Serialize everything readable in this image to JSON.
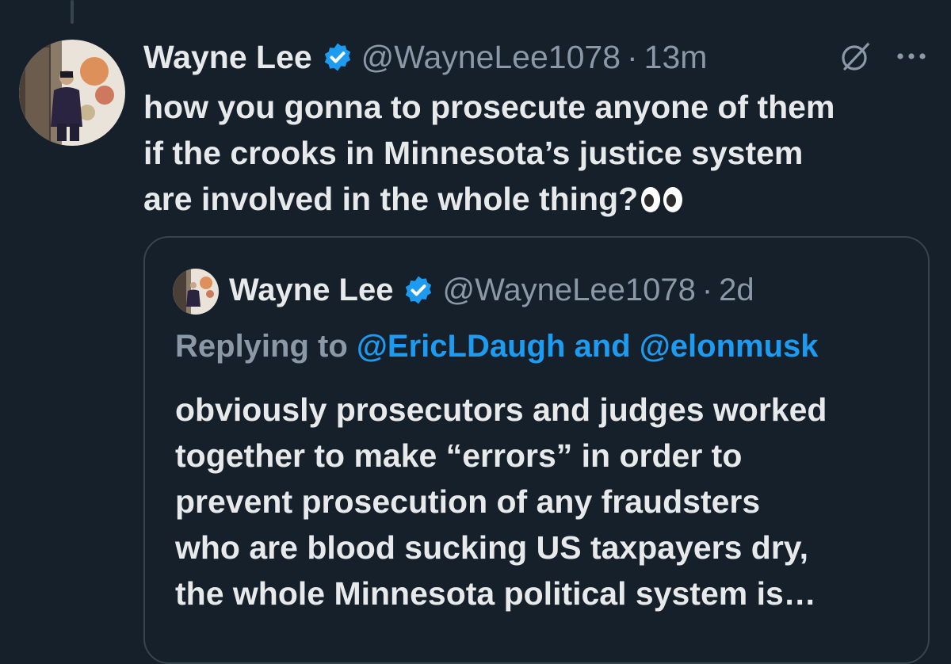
{
  "tweet": {
    "author_name": "Wayne Lee",
    "handle": "@WayneLee1078",
    "separator": "·",
    "time": "13m",
    "text_lines": [
      "how you gonna to prosecute anyone of them",
      "if the crooks in Minnesota’s justice system",
      "are involved in the whole thing?"
    ],
    "emoji": "eyes-emoji"
  },
  "quoted_tweet": {
    "author_name": "Wayne Lee",
    "handle": "@WayneLee1078",
    "separator": "·",
    "time": "2d",
    "replying_prefix": "Replying to",
    "mention_1": "@EricLDaugh",
    "mention_joiner": "and",
    "mention_2": "@elonmusk",
    "text_lines": [
      "obviously prosecutors and judges worked",
      "together to make “errors” in order to",
      "prevent prosecution of any fraudsters",
      "who are blood sucking US taxpayers dry,",
      "the whole Minnesota political system is…"
    ]
  },
  "icons": {
    "verified": "verified-badge-icon",
    "grok": "grok-icon",
    "more": "more-options-icon"
  },
  "colors": {
    "background": "#15202b",
    "text": "#e7e9ea",
    "muted": "#8b98a5",
    "accent": "#1d9bf0",
    "border": "#38444d"
  }
}
